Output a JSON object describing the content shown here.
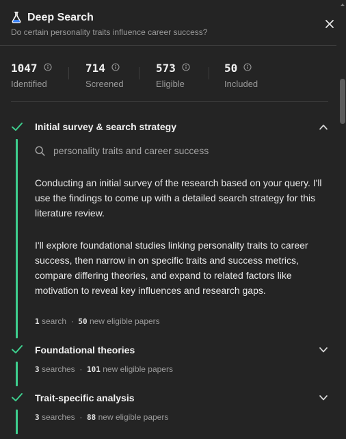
{
  "header": {
    "title": "Deep Search",
    "subtitle": "Do certain personality traits influence career success?"
  },
  "stats": [
    {
      "value": "1047",
      "label": "Identified"
    },
    {
      "value": "714",
      "label": "Screened"
    },
    {
      "value": "573",
      "label": "Eligible"
    },
    {
      "value": "50",
      "label": "Included"
    }
  ],
  "steps": [
    {
      "title": "Initial survey & search strategy",
      "expanded": true,
      "query": "personality traits and career success",
      "paragraphs": [
        "Conducting an initial survey of the research based on your query. I'll use the findings to come up with a detailed search strategy for this literature review.",
        "I'll explore foundational studies linking personality traits to career success, then narrow in on specific traits and success metrics, compare differing theories, and expand to related factors like motivation to reveal key influences and research gaps."
      ],
      "meta": {
        "searches_count": "1",
        "searches_label": "search",
        "dot": "·",
        "papers_count": "50",
        "papers_label": "new eligible papers"
      }
    },
    {
      "title": "Foundational theories",
      "expanded": false,
      "meta": {
        "searches_count": "3",
        "searches_label": "searches",
        "dot": "·",
        "papers_count": "101",
        "papers_label": "new eligible papers"
      }
    },
    {
      "title": "Trait-specific analysis",
      "expanded": false,
      "meta": {
        "searches_count": "3",
        "searches_label": "searches",
        "dot": "·",
        "papers_count": "88",
        "papers_label": "new eligible papers"
      }
    }
  ],
  "icons": {
    "logo": "flask-icon",
    "close": "close-icon",
    "info": "info-icon",
    "check": "check-icon",
    "chevron_up": "chevron-up-icon",
    "chevron_down": "chevron-down-icon",
    "search": "search-icon"
  },
  "colors": {
    "background": "#242424",
    "accent_green": "#3ecf8e",
    "muted_text": "#9b9b9b",
    "divider": "#3c3c3c"
  }
}
